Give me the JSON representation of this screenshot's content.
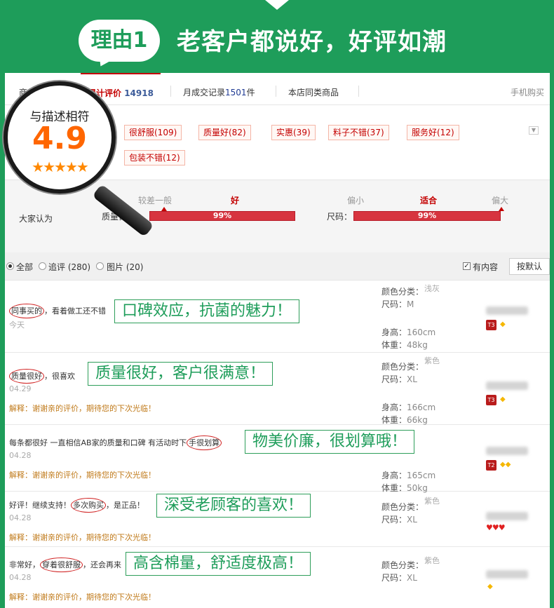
{
  "header": {
    "badge": "理由1",
    "headline": "老客户都说好，好评如潮"
  },
  "tabs": [
    {
      "label": "商品"
    },
    {
      "label": "累计评价",
      "count": "14918"
    },
    {
      "label": "月成交记录",
      "count": "1501",
      "suffix": "件"
    },
    {
      "label": "本店同类商品"
    }
  ],
  "mobile_buy": "手机购买",
  "rating": {
    "label": "与描述相符",
    "score": "4.9",
    "stars": "★★★★★"
  },
  "tags": [
    "很舒服(109)",
    "质量好(82)",
    "实惠(39)",
    "料子不错(37)",
    "服务好(12)",
    "包装不错(12)"
  ],
  "consensus": {
    "label": "大家认为",
    "quality": {
      "label": "质量做工：",
      "scale": [
        "较差",
        "一般",
        "好"
      ],
      "selected": "好",
      "value": "99%",
      "fill": 0.99
    },
    "size": {
      "label": "尺码：",
      "scale": [
        "偏小",
        "适合",
        "偏大"
      ],
      "selected": "适合",
      "value": "99%",
      "fill": 0.99
    }
  },
  "filter": {
    "all": "全部",
    "append": "追评 (280)",
    "pictures": "图片 (20)",
    "has_content": "有内容",
    "sort": "按默认"
  },
  "reviews": [
    {
      "pre": "",
      "highlight": "同事买的",
      "post": "，看着做工还不错",
      "date": "今天",
      "reply": "",
      "callout": "口碑效应，抗菌的魅力！",
      "color_label": "颜色分类：",
      "color_value": "浅灰",
      "size_label": "尺码：",
      "size_value": "M",
      "height_label": "身高：",
      "height_value": "160cm",
      "weight_label": "体重：",
      "weight_value": "48kg",
      "level": "T3",
      "badge_icon": "diamond-icon"
    },
    {
      "pre": "",
      "highlight": "质量很好",
      "post": "，很喜欢",
      "date": "04.29",
      "reply": "解释：谢谢亲的评价，期待您的下次光临！",
      "callout": "质量很好，客户很满意！",
      "color_label": "颜色分类：",
      "color_value": "紫色",
      "size_label": "尺码：",
      "size_value": "XL",
      "height_label": "身高：",
      "height_value": "166cm",
      "weight_label": "体重：",
      "weight_value": "66kg",
      "level": "T3",
      "badge_icon": "diamond-icon"
    },
    {
      "pre": "每条都很好 一直相信AB家的质量和口碑 有活动时下",
      "highlight": "手很划算",
      "post": "",
      "date": "04.28",
      "reply": "解释：谢谢亲的评价，期待您的下次光临！",
      "callout": "物美价廉，很划算哦！",
      "color_label": "颜色分类：",
      "color_value": "",
      "size_label": "尺码：",
      "size_value": "",
      "height_label": "身高：",
      "height_value": "165cm",
      "weight_label": "体重：",
      "weight_value": "50kg",
      "level": "T2",
      "badge_icon": "diamond-icon"
    },
    {
      "pre": "好评！继续支持！",
      "highlight": "多次购买",
      "post": "，是正品！",
      "date": "04.28",
      "reply": "解释：谢谢亲的评价，期待您的下次光临！",
      "callout": "深受老顾客的喜欢！",
      "color_label": "颜色分类：",
      "color_value": "紫色",
      "size_label": "尺码：",
      "size_value": "XL",
      "height_label": "",
      "height_value": "",
      "weight_label": "",
      "weight_value": "",
      "level": "",
      "badge_icon": "heart-icon"
    },
    {
      "pre": "非常好，",
      "highlight": "穿着很舒服",
      "post": "，还会再来",
      "date": "04.28",
      "reply": "解释：谢谢亲的评价，期待您的下次光临！",
      "callout": "高含棉量，舒适度极高！",
      "color_label": "颜色分类：",
      "color_value": "紫色",
      "size_label": "尺码：",
      "size_value": "XL",
      "height_label": "",
      "height_value": "",
      "weight_label": "",
      "weight_value": "",
      "level": "",
      "badge_icon": "diamond-icon"
    }
  ]
}
